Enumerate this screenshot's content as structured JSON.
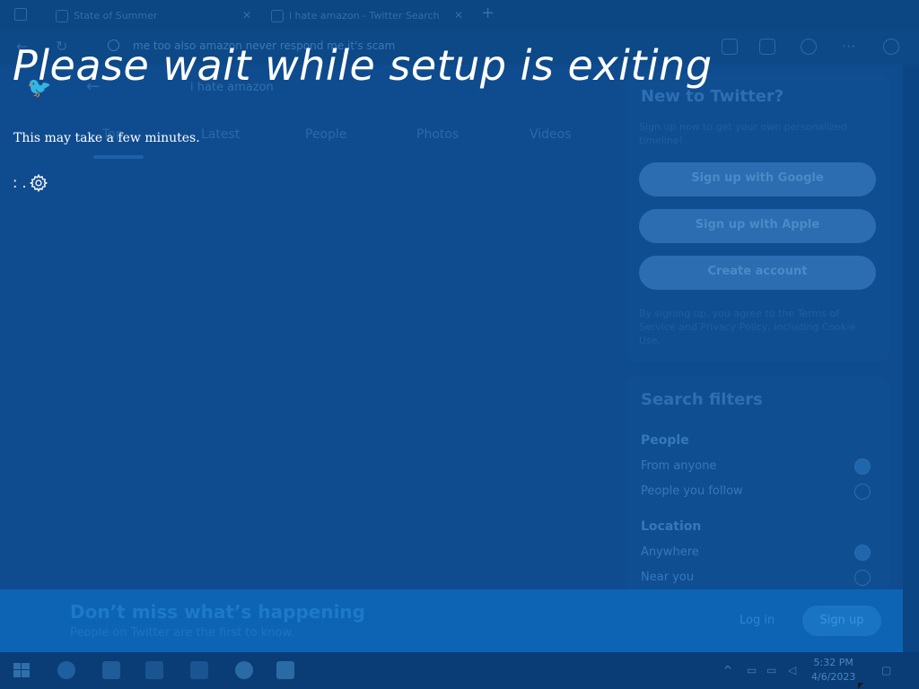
{
  "browser": {
    "tabs": [
      {
        "title": "State of Summer"
      },
      {
        "title": "i hate amazon - Twitter Search"
      }
    ],
    "address": "me too also amazon never respond me it's scam"
  },
  "twitter": {
    "search_value": "i hate amazon",
    "tabs": [
      "Top",
      "Latest",
      "People",
      "Photos",
      "Videos"
    ],
    "new_heading": "New to Twitter?",
    "new_sub": "Sign up now to get your own personalized timeline!",
    "btn_google": "Sign up with Google",
    "btn_apple": "Sign up with Apple",
    "btn_create": "Create account",
    "terms": "By signing up, you agree to the Terms of Service and Privacy Policy, including Cookie Use.",
    "filters_heading": "Search filters",
    "people_label": "People",
    "people_opt1": "From anyone",
    "people_opt2": "People you follow",
    "location_label": "Location",
    "location_opt1": "Anywhere",
    "location_opt2": "Near you",
    "banner_heading": "Don’t miss what’s happening",
    "banner_sub": "People on Twitter are the first to know.",
    "banner_login": "Log in",
    "banner_signup": "Sign up"
  },
  "taskbar": {
    "time": "5:32 PM",
    "date": "4/6/2023"
  },
  "setup": {
    "title": "Please wait while setup is exiting",
    "subtitle": "This may take a few minutes.",
    "progress": ": ."
  },
  "colors": {
    "overlay": "#0a3f78",
    "text": "#ffffff"
  }
}
